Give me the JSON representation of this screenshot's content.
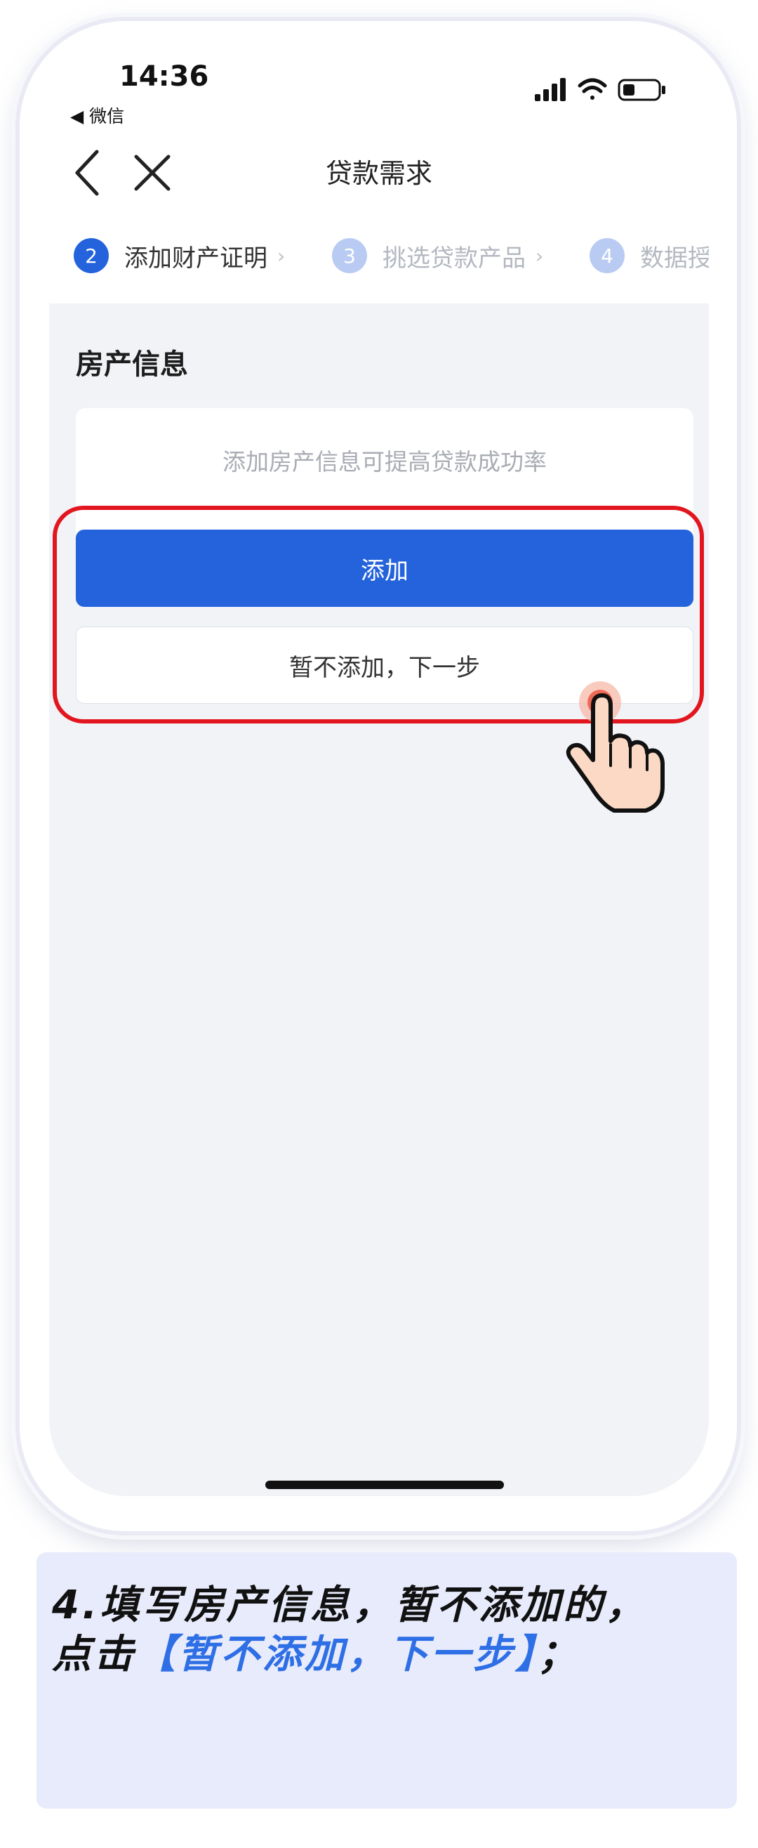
{
  "status_bar": {
    "time": "14:36",
    "back_app": "◀ 微信"
  },
  "nav": {
    "title": "贷款需求"
  },
  "steps": [
    {
      "num": "2",
      "label": "添加财产证明",
      "active": true
    },
    {
      "num": "3",
      "label": "挑选贷款产品",
      "active": false
    },
    {
      "num": "4",
      "label": "数据授",
      "active": false
    }
  ],
  "section": {
    "title": "房产信息",
    "hint": "添加房产信息可提高贷款成功率",
    "add_label": "添加",
    "skip_label": "暂不添加，下一步"
  },
  "caption": {
    "line1": "4.填写房产信息，暂不添加的，",
    "line2_prefix": "点击",
    "line2_highlight": "【暂不添加，下一步】",
    "line2_suffix": "；"
  },
  "colors": {
    "primary": "#2463dc",
    "step_inactive": "#b9cbf3",
    "highlight_border": "#e2161e",
    "caption_bg": "#e8ebfb",
    "caption_highlight": "#2f6fe6"
  }
}
